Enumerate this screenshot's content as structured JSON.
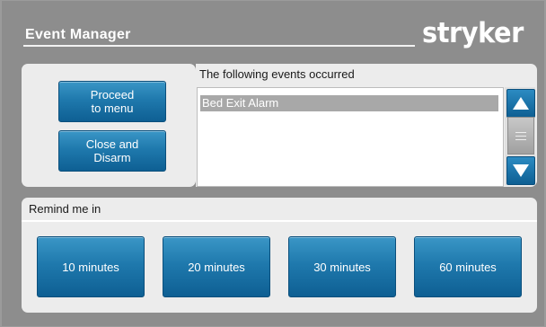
{
  "header": {
    "title": "Event Manager",
    "brand": "stryker"
  },
  "actions": {
    "proceed_label": "Proceed\nto menu",
    "close_label": "Close and\nDisarm"
  },
  "events": {
    "title": "The following events occurred",
    "items": [
      "Bed Exit Alarm"
    ]
  },
  "scrollbar": {
    "up_icon": "arrow-up-icon",
    "down_icon": "arrow-down-icon",
    "thumb_icon": "grip-icon"
  },
  "remind": {
    "label": "Remind me in",
    "options": [
      "10 minutes",
      "20 minutes",
      "30 minutes",
      "60 minutes"
    ]
  },
  "colors": {
    "button_top": "#3a96c6",
    "button_bottom": "#0e5f93",
    "background": "#9b9b9b",
    "panel": "#ececec"
  }
}
